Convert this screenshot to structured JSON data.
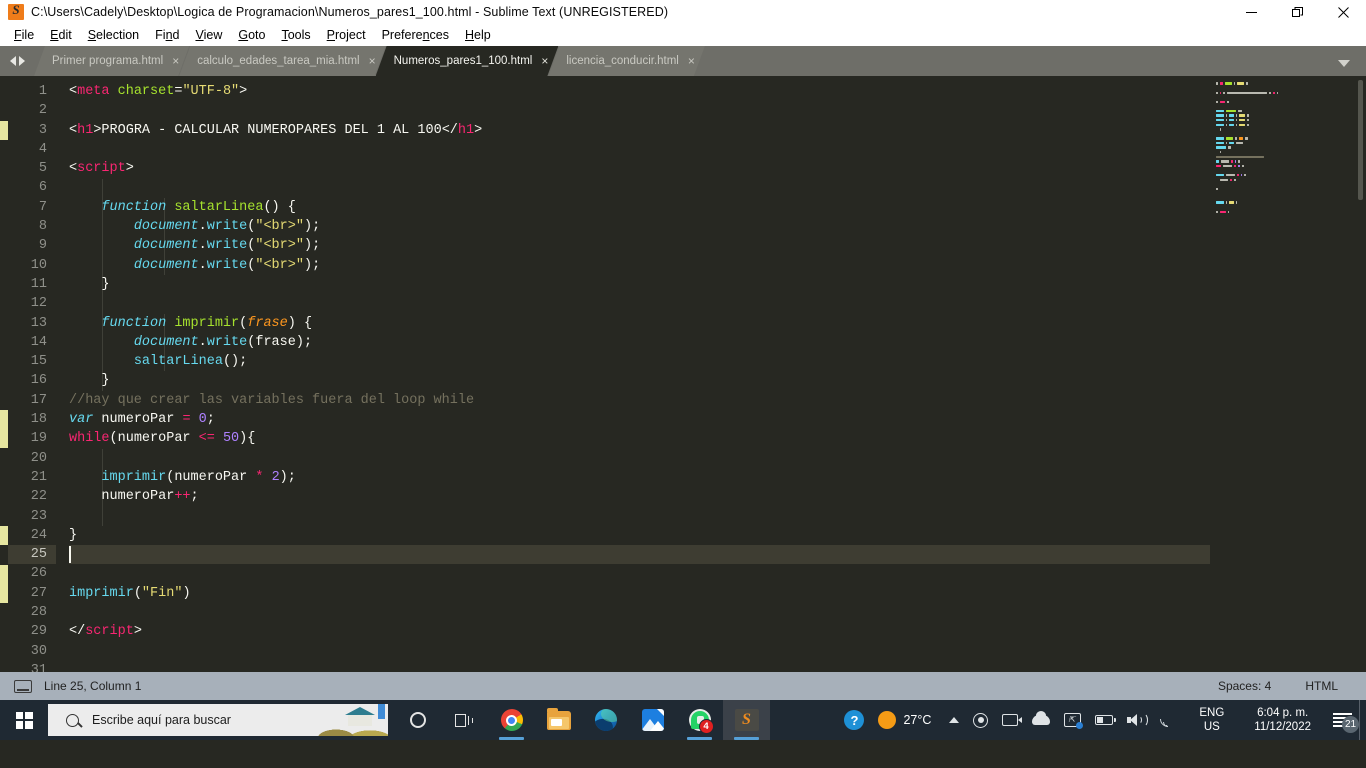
{
  "window": {
    "title": "C:\\Users\\Cadely\\Desktop\\Logica de Programacion\\Numeros_pares1_100.html - Sublime Text (UNREGISTERED)",
    "app_icon": "sublime-text-icon",
    "controls": {
      "minimize": "minimize-icon",
      "maximize": "restore-icon",
      "close": "close-icon"
    }
  },
  "menubar": {
    "items": [
      {
        "label": "File"
      },
      {
        "label": "Edit"
      },
      {
        "label": "Selection"
      },
      {
        "label": "Find"
      },
      {
        "label": "View"
      },
      {
        "label": "Goto"
      },
      {
        "label": "Tools"
      },
      {
        "label": "Project"
      },
      {
        "label": "Preferences"
      },
      {
        "label": "Help"
      }
    ]
  },
  "tabs": {
    "items": [
      {
        "label": "Primer programa.html",
        "active": false,
        "close": "×"
      },
      {
        "label": "calculo_edades_tarea_mia.html",
        "active": false,
        "close": "×"
      },
      {
        "label": "Numeros_pares1_100.html",
        "active": true,
        "close": "×"
      },
      {
        "label": "licencia_conducir.html",
        "active": false,
        "close": "×"
      }
    ],
    "dropdown_icon": "chevron-down-icon",
    "nav_prev_icon": "chevron-left-icon",
    "nav_next_icon": "chevron-right-icon"
  },
  "editor": {
    "first_line": 1,
    "total_lines": 31,
    "active_line": 25,
    "modified_line_marks": [
      3,
      18,
      19,
      24,
      26,
      27
    ],
    "lines": [
      {
        "n": 1,
        "tokens": [
          {
            "t": "punc",
            "s": "<"
          },
          {
            "t": "tag",
            "s": "meta"
          },
          {
            "t": "plain",
            "s": " "
          },
          {
            "t": "attr",
            "s": "charset"
          },
          {
            "t": "punc",
            "s": "="
          },
          {
            "t": "str",
            "s": "\"UTF-8\""
          },
          {
            "t": "punc",
            "s": ">"
          }
        ]
      },
      {
        "n": 2,
        "tokens": []
      },
      {
        "n": 3,
        "tokens": [
          {
            "t": "punc",
            "s": "<"
          },
          {
            "t": "tag",
            "s": "h1"
          },
          {
            "t": "punc",
            "s": ">"
          },
          {
            "t": "plain",
            "s": "PROGRA - CALCULAR NUMEROPARES DEL 1 AL 100"
          },
          {
            "t": "punc",
            "s": "</"
          },
          {
            "t": "tag",
            "s": "h1"
          },
          {
            "t": "punc",
            "s": ">"
          }
        ]
      },
      {
        "n": 4,
        "tokens": []
      },
      {
        "n": 5,
        "tokens": [
          {
            "t": "punc",
            "s": "<"
          },
          {
            "t": "tag",
            "s": "script"
          },
          {
            "t": "punc",
            "s": ">"
          }
        ]
      },
      {
        "n": 6,
        "tokens": []
      },
      {
        "n": 7,
        "tokens": [
          {
            "t": "plain",
            "s": "    "
          },
          {
            "t": "kwi",
            "s": "function"
          },
          {
            "t": "plain",
            "s": " "
          },
          {
            "t": "fn",
            "s": "saltarLinea"
          },
          {
            "t": "punc",
            "s": "() {"
          }
        ]
      },
      {
        "n": 8,
        "tokens": [
          {
            "t": "plain",
            "s": "        "
          },
          {
            "t": "obj",
            "s": "document"
          },
          {
            "t": "punc",
            "s": "."
          },
          {
            "t": "meth",
            "s": "write"
          },
          {
            "t": "punc",
            "s": "("
          },
          {
            "t": "str",
            "s": "\"<br>\""
          },
          {
            "t": "punc",
            "s": ");"
          }
        ]
      },
      {
        "n": 9,
        "tokens": [
          {
            "t": "plain",
            "s": "        "
          },
          {
            "t": "obj",
            "s": "document"
          },
          {
            "t": "punc",
            "s": "."
          },
          {
            "t": "meth",
            "s": "write"
          },
          {
            "t": "punc",
            "s": "("
          },
          {
            "t": "str",
            "s": "\"<br>\""
          },
          {
            "t": "punc",
            "s": ");"
          }
        ]
      },
      {
        "n": 10,
        "tokens": [
          {
            "t": "plain",
            "s": "        "
          },
          {
            "t": "obj",
            "s": "document"
          },
          {
            "t": "punc",
            "s": "."
          },
          {
            "t": "meth",
            "s": "write"
          },
          {
            "t": "punc",
            "s": "("
          },
          {
            "t": "str",
            "s": "\"<br>\""
          },
          {
            "t": "punc",
            "s": ");"
          }
        ]
      },
      {
        "n": 11,
        "tokens": [
          {
            "t": "plain",
            "s": "    }"
          }
        ]
      },
      {
        "n": 12,
        "tokens": []
      },
      {
        "n": 13,
        "tokens": [
          {
            "t": "plain",
            "s": "    "
          },
          {
            "t": "kwi",
            "s": "function"
          },
          {
            "t": "plain",
            "s": " "
          },
          {
            "t": "fn",
            "s": "imprimir"
          },
          {
            "t": "punc",
            "s": "("
          },
          {
            "t": "param",
            "s": "frase"
          },
          {
            "t": "punc",
            "s": ") {"
          }
        ]
      },
      {
        "n": 14,
        "tokens": [
          {
            "t": "plain",
            "s": "        "
          },
          {
            "t": "obj",
            "s": "document"
          },
          {
            "t": "punc",
            "s": "."
          },
          {
            "t": "meth",
            "s": "write"
          },
          {
            "t": "punc",
            "s": "(frase);"
          }
        ]
      },
      {
        "n": 15,
        "tokens": [
          {
            "t": "plain",
            "s": "        "
          },
          {
            "t": "meth",
            "s": "saltarLinea"
          },
          {
            "t": "punc",
            "s": "();"
          }
        ]
      },
      {
        "n": 16,
        "tokens": [
          {
            "t": "plain",
            "s": "    }"
          }
        ]
      },
      {
        "n": 17,
        "tokens": [
          {
            "t": "cmt",
            "s": "//hay que crear las variables fuera del loop while"
          }
        ]
      },
      {
        "n": 18,
        "tokens": [
          {
            "t": "kwi",
            "s": "var"
          },
          {
            "t": "plain",
            "s": " numeroPar "
          },
          {
            "t": "op",
            "s": "="
          },
          {
            "t": "plain",
            "s": " "
          },
          {
            "t": "num",
            "s": "0"
          },
          {
            "t": "punc",
            "s": ";"
          }
        ]
      },
      {
        "n": 19,
        "tokens": [
          {
            "t": "kw",
            "s": "while"
          },
          {
            "t": "punc",
            "s": "(numeroPar "
          },
          {
            "t": "op",
            "s": "<="
          },
          {
            "t": "punc",
            "s": " "
          },
          {
            "t": "num",
            "s": "50"
          },
          {
            "t": "punc",
            "s": "){"
          }
        ]
      },
      {
        "n": 20,
        "tokens": []
      },
      {
        "n": 21,
        "tokens": [
          {
            "t": "plain",
            "s": "    "
          },
          {
            "t": "meth",
            "s": "imprimir"
          },
          {
            "t": "punc",
            "s": "(numeroPar "
          },
          {
            "t": "op",
            "s": "*"
          },
          {
            "t": "punc",
            "s": " "
          },
          {
            "t": "num",
            "s": "2"
          },
          {
            "t": "punc",
            "s": ");"
          }
        ]
      },
      {
        "n": 22,
        "tokens": [
          {
            "t": "plain",
            "s": "    numeroPar"
          },
          {
            "t": "op",
            "s": "++"
          },
          {
            "t": "punc",
            "s": ";"
          }
        ]
      },
      {
        "n": 23,
        "tokens": []
      },
      {
        "n": 24,
        "tokens": [
          {
            "t": "plain",
            "s": "}"
          }
        ]
      },
      {
        "n": 25,
        "tokens": []
      },
      {
        "n": 26,
        "tokens": []
      },
      {
        "n": 27,
        "tokens": [
          {
            "t": "meth",
            "s": "imprimir"
          },
          {
            "t": "punc",
            "s": "("
          },
          {
            "t": "str",
            "s": "\"Fin\""
          },
          {
            "t": "punc",
            "s": ")"
          }
        ]
      },
      {
        "n": 28,
        "tokens": []
      },
      {
        "n": 29,
        "tokens": [
          {
            "t": "punc",
            "s": "</"
          },
          {
            "t": "tag",
            "s": "script"
          },
          {
            "t": "punc",
            "s": ">"
          }
        ]
      },
      {
        "n": 30,
        "tokens": []
      },
      {
        "n": 31,
        "tokens": []
      }
    ]
  },
  "minimap": {
    "visible": true,
    "scrollbar": "minimap-scrollbar"
  },
  "statusbar": {
    "left_icon": "encoding-icon",
    "cursor_position": "Line 25, Column 1",
    "indentation": "Spaces: 4",
    "syntax": "HTML"
  },
  "taskbar": {
    "start_icon": "windows-start-icon",
    "search": {
      "placeholder": "Escribe aquí para buscar",
      "icon": "search-icon"
    },
    "items": [
      {
        "name": "cortana-icon",
        "label": "Cortana"
      },
      {
        "name": "task-view-icon",
        "label": "Vista de tareas"
      },
      {
        "name": "chrome-icon",
        "label": "Google Chrome",
        "running": true
      },
      {
        "name": "file-explorer-icon",
        "label": "Explorador de archivos"
      },
      {
        "name": "edge-icon",
        "label": "Microsoft Edge"
      },
      {
        "name": "photos-icon",
        "label": "Fotos"
      },
      {
        "name": "whatsapp-icon",
        "label": "WhatsApp",
        "badge": "4",
        "running": true
      },
      {
        "name": "sublime-text-icon",
        "label": "Sublime Text",
        "active": true
      }
    ],
    "tray": {
      "help_icon": "help-icon",
      "weather_icon": "sun-icon",
      "weather_temp": "27°C",
      "overflow_icon": "chevron-up-icon",
      "icons": [
        "record-icon",
        "camera-icon",
        "onedrive-icon",
        "screen-share-icon",
        "battery-icon",
        "volume-icon",
        "wifi-icon"
      ],
      "language_line1": "ENG",
      "language_line2": "US",
      "time": "6:04 p. m.",
      "date": "11/12/2022",
      "notifications_icon": "notifications-icon",
      "notifications_count": "21"
    }
  },
  "colors": {
    "editor_bg": "#272822",
    "active_line": "#3e3d32",
    "tab_bar": "#6e6e68",
    "accent_pink": "#f92672",
    "accent_green": "#a6e22e",
    "accent_blue": "#66d9ef",
    "accent_yellow": "#e6db74",
    "accent_purple": "#ae81ff",
    "accent_orange": "#fd971f",
    "comment": "#75715e",
    "statusbar_bg": "#a7b0ba",
    "taskbar_bg": "#1f2933",
    "modified_mark": "#e6e6a0"
  }
}
